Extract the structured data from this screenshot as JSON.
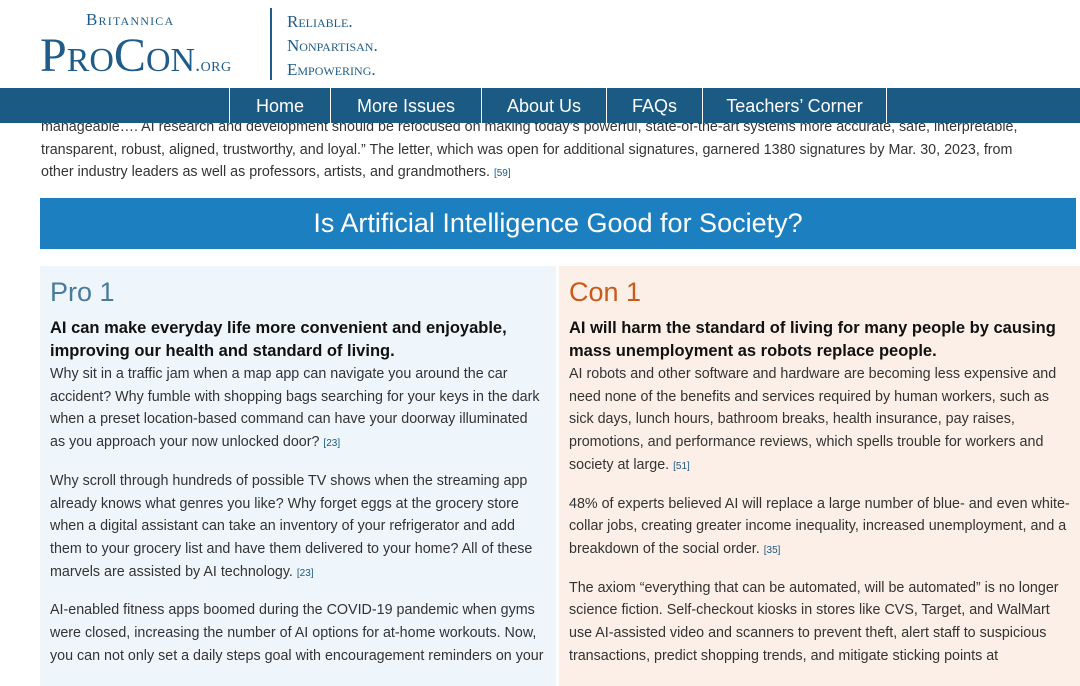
{
  "header": {
    "brand_top": "Britannica",
    "brand_name": "ProCon",
    "brand_suffix": ".org",
    "tagline": [
      "Reliable.",
      "Nonpartisan.",
      "Empowering."
    ]
  },
  "nav": {
    "items": [
      {
        "label": "Home"
      },
      {
        "label": "More Issues"
      },
      {
        "label": "About Us"
      },
      {
        "label": "FAQs"
      },
      {
        "label": "Teachers’ Corner"
      }
    ]
  },
  "intro": {
    "text": "manageable…. AI research and development should be refocused on making today’s powerful, state-of-the-art systems more accurate, safe, interpretable, transparent, robust, aligned, trustworthy, and loyal.” The letter, which was open for additional signatures, garnered 1380 signatures by Mar. 30, 2023, from other industry leaders as well as professors, artists, and grandmothers.",
    "cite": "[59]"
  },
  "banner": {
    "title": "Is Artificial Intelligence Good for Society?"
  },
  "pro": {
    "heading": "Pro 1",
    "claim": "AI can make everyday life more convenient and enjoyable, improving our health and standard of living.",
    "paragraphs": [
      {
        "text": "Why sit in a traffic jam when a map app can navigate you around the car accident? Why fumble with shopping bags searching for your keys in the dark when a preset location-based command can have your doorway illuminated as you approach your now unlocked door?",
        "cite": "[23]"
      },
      {
        "text": "Why scroll through hundreds of possible TV shows when the streaming app already knows what genres you like? Why forget eggs at the grocery store when a digital assistant can take an inventory of your refrigerator and add them to your grocery list and have them delivered to your home? All of these marvels are assisted by AI technology.",
        "cite": "[23]"
      },
      {
        "text": "AI-enabled fitness apps boomed during the COVID-19 pandemic when gyms were closed, increasing the number of AI options for at-home workouts. Now, you can not only set a daily steps goal with encouragement reminders on your",
        "cite": ""
      }
    ]
  },
  "con": {
    "heading": "Con 1",
    "claim": "AI will harm the standard of living for many people by causing mass unemployment as robots replace people.",
    "paragraphs": [
      {
        "text": "AI robots and other software and hardware are becoming less expensive and need none of the benefits and services required by human workers, such as sick days, lunch hours, bathroom breaks, health insurance, pay raises, promotions, and performance reviews, which spells trouble for workers and society at large.",
        "cite": "[51]"
      },
      {
        "text": "48% of experts believed AI will replace a large number of blue- and even white-collar jobs, creating greater income inequality, increased unemployment, and a breakdown of the social order.",
        "cite": "[35]"
      },
      {
        "text": "The axiom “everything that can be automated, will be automated” is no longer science fiction. Self-checkout kiosks in stores like CVS, Target, and WalMart use AI-assisted video and scanners to prevent theft, alert staff to suspicious transactions, predict shopping trends, and mitigate sticking points at",
        "cite": ""
      }
    ]
  },
  "colors": {
    "brand_blue": "#1f5c8a",
    "nav_bg": "#1b5a82",
    "banner_bg": "#1c7fc0",
    "pro_bg": "#eef6fc",
    "con_bg": "#fcefe7",
    "con_accent": "#c85a1a"
  }
}
